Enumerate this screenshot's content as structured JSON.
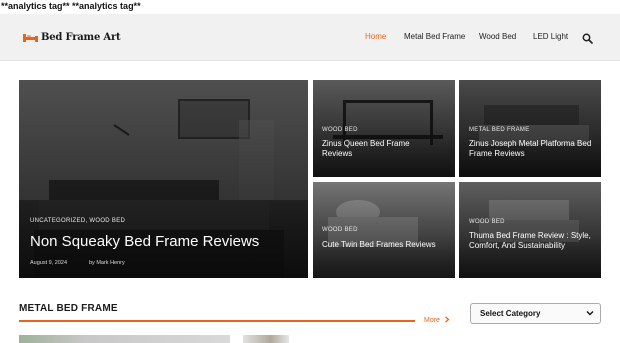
{
  "top_note": "**analytics tag** **analytics tag**",
  "site": {
    "name": "Bed Frame Art"
  },
  "nav": {
    "items": [
      {
        "label": "Home",
        "active": true
      },
      {
        "label": "Metal Bed Frame",
        "active": false
      },
      {
        "label": "Wood Bed",
        "active": false
      },
      {
        "label": "LED Light",
        "active": false
      }
    ],
    "search_icon": "search-icon"
  },
  "featured": {
    "main": {
      "category": "UNCATEGORIZED,  WOOD BED",
      "title": "Non Squeaky Bed Frame Reviews",
      "date": "August 9, 2024",
      "author": "by Mark Henry"
    },
    "cards": [
      {
        "category": "WOOD BED",
        "title": "Zinus Queen Bed Frame Reviews"
      },
      {
        "category": "METAL BED FRAME",
        "title": "Zinus Joseph Metal Platforma Bed Frame Reviews"
      },
      {
        "category": "WOOD BED",
        "title": "Cute Twin Bed Frames Reviews"
      },
      {
        "category": "WOOD BED",
        "title": "Thuma Bed Frame Review : Style, Comfort, And Sustainability"
      }
    ]
  },
  "section": {
    "title": "METAL BED FRAME",
    "more_label": "More"
  },
  "category_select": {
    "value": "Select Category"
  },
  "colors": {
    "accent": "#e8641b",
    "header_bg": "#f1f1f1"
  }
}
